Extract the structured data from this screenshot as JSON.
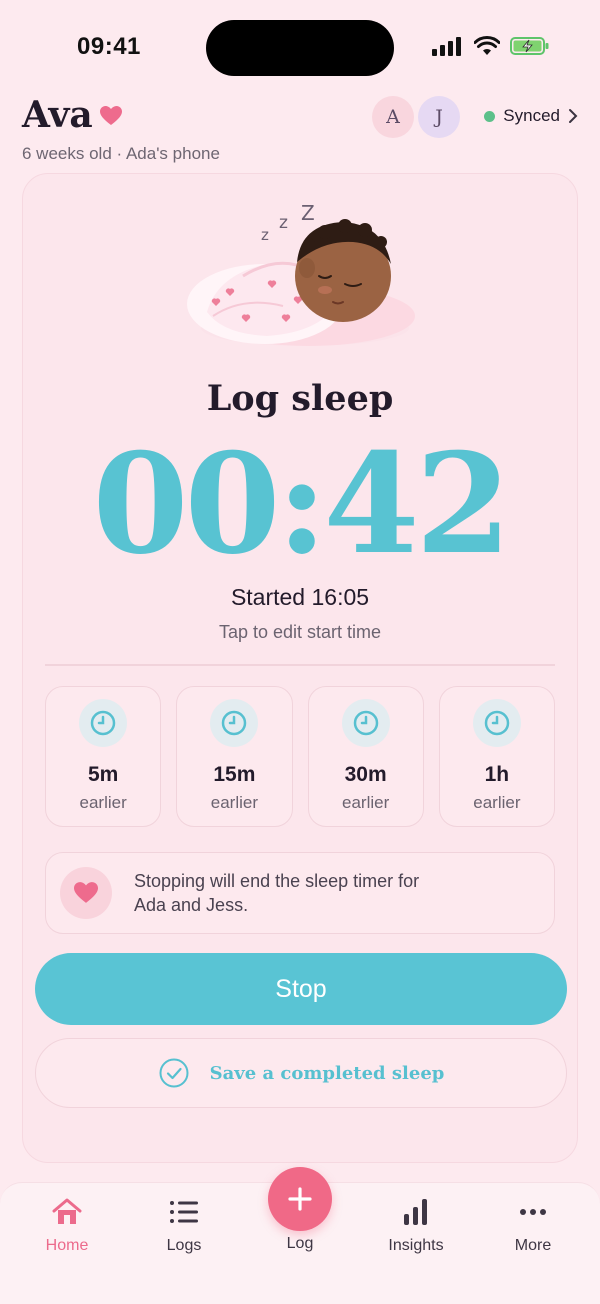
{
  "status_bar": {
    "time": "09:41"
  },
  "header": {
    "baby_name": "Ava",
    "subtitle": "6 weeks old · Ada's phone",
    "avatars": [
      "A",
      "J"
    ],
    "sync_label": "Synced"
  },
  "sleep": {
    "title": "Log sleep",
    "timer": "00:42",
    "started": "Started 16:05",
    "edit_hint": "Tap to edit start time",
    "zzz": [
      "z",
      "z",
      "Z"
    ]
  },
  "quick_adjust": [
    {
      "amount": "5m",
      "label": "earlier"
    },
    {
      "amount": "15m",
      "label": "earlier"
    },
    {
      "amount": "30m",
      "label": "earlier"
    },
    {
      "amount": "1h",
      "label": "earlier"
    }
  ],
  "notice": {
    "text": "Stopping will end the sleep timer for Ada and Jess."
  },
  "actions": {
    "stop_label": "Stop",
    "save_label": "Save a completed sleep"
  },
  "tabbar": {
    "tabs": [
      {
        "label": "Home",
        "icon": "home-icon",
        "active": true
      },
      {
        "label": "Logs",
        "icon": "list-icon",
        "active": false
      },
      {
        "label": "Log",
        "icon": "plus-icon",
        "active": false
      },
      {
        "label": "Insights",
        "icon": "bar-chart-icon",
        "active": false
      },
      {
        "label": "More",
        "icon": "more-icon",
        "active": false
      }
    ]
  },
  "colors": {
    "accent": "#59c4d4",
    "brand_pink": "#f06987",
    "background": "#fdeaef"
  }
}
